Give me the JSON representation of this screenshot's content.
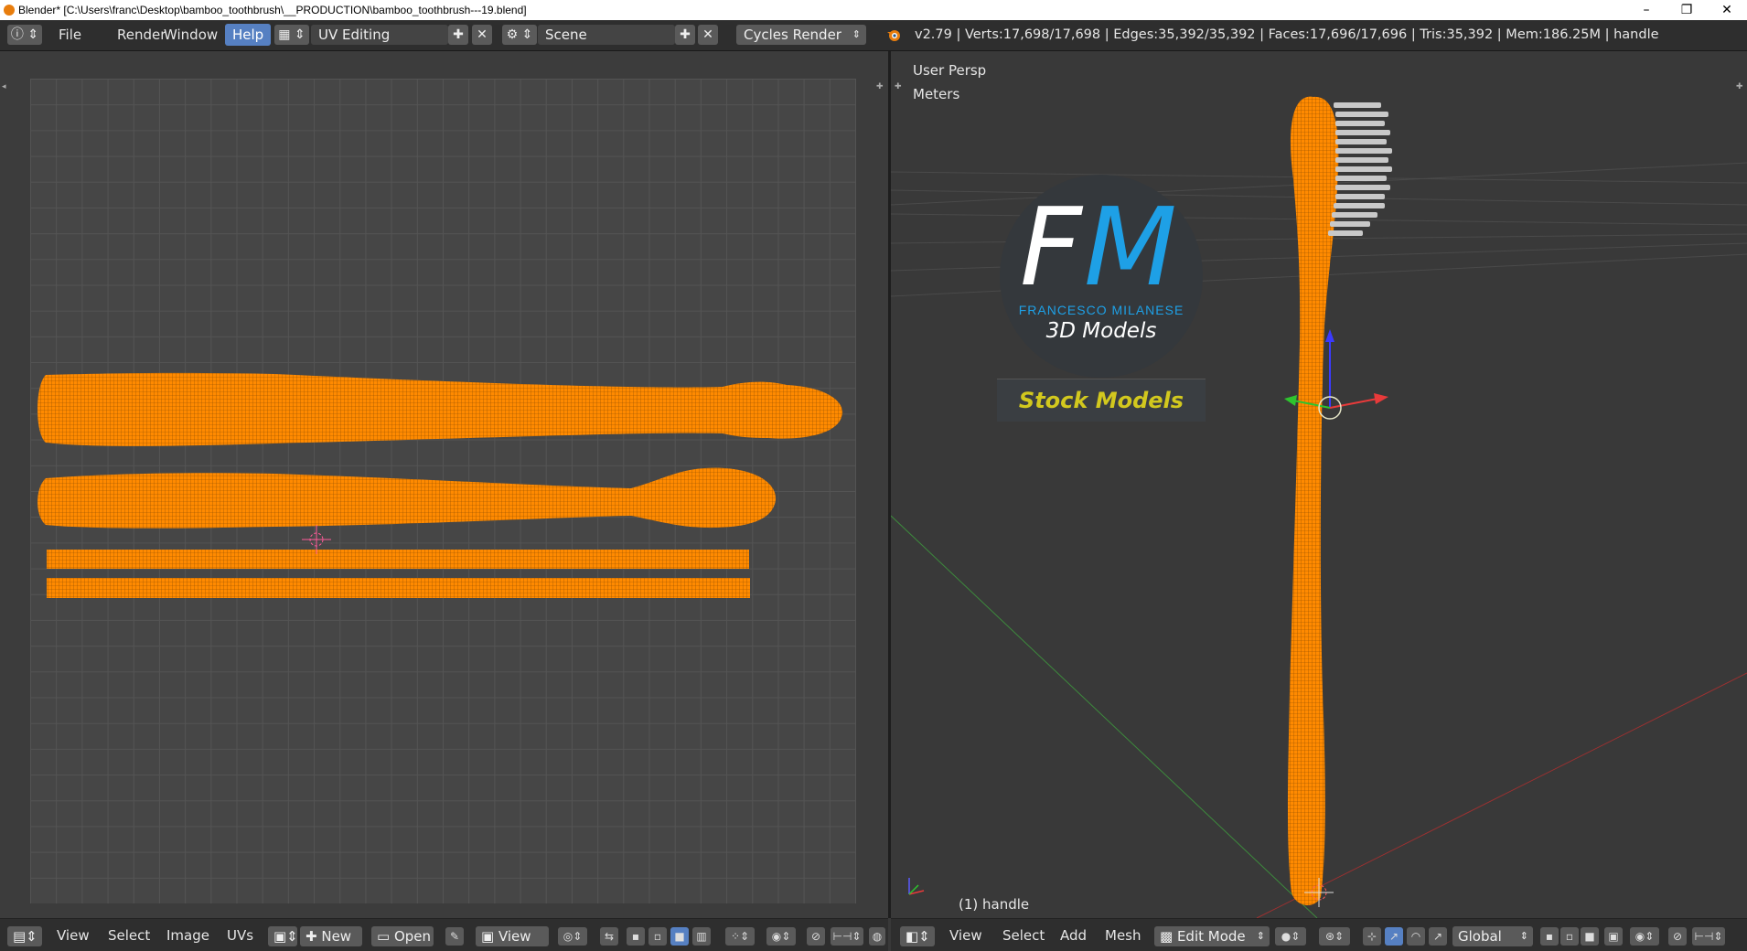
{
  "window": {
    "title": "Blender* [C:\\Users\\franc\\Desktop\\bamboo_toothbrush\\__PRODUCTION\\bamboo_toothbrush---19.blend]",
    "minimize": "–",
    "restore": "❐",
    "close": "✕"
  },
  "info_bar": {
    "menu": [
      "File",
      "Render",
      "Window",
      "Help"
    ],
    "layout": "UV Editing",
    "scene": "Scene",
    "engine": "Cycles Render",
    "stats": "v2.79 | Verts:17,698/17,698 | Edges:35,392/35,392 | Faces:17,696/17,696 | Tris:35,392 | Mem:186.25M | handle"
  },
  "viewport": {
    "view_name": "User Persp",
    "units": "Meters",
    "object_label": "(1) handle"
  },
  "logo": {
    "letter_f": "F",
    "letter_m": "M",
    "name": "FRANCESCO MILANESE",
    "tagline": "3D Models",
    "banner": "Stock Models"
  },
  "uv_footer": {
    "menu": [
      "View",
      "Select",
      "Image",
      "UVs"
    ],
    "new_label": "New",
    "open_label": "Open",
    "view_label": "View"
  },
  "view3d_footer": {
    "menu": [
      "View",
      "Select",
      "Add",
      "Mesh"
    ],
    "mode": "Edit Mode",
    "orientation": "Global"
  },
  "colors": {
    "mesh_orange": "#ff8a00",
    "accent_blue": "#5680c2",
    "logo_blue": "#1ea0e6",
    "banner_yellow": "#d2c81e"
  },
  "icons": [
    "info-icon",
    "screen-layout-icon",
    "scene-icon",
    "blender-logo-icon",
    "image-editor-icon",
    "view3d-icon",
    "shading-icon",
    "pivot-icon",
    "manipulator-icon"
  ]
}
